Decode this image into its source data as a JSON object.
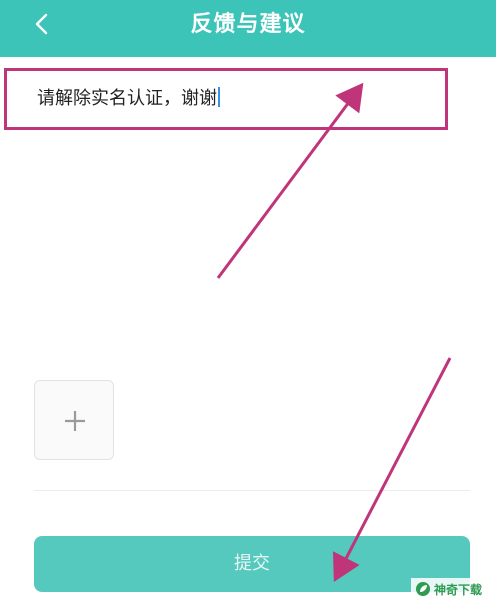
{
  "header": {
    "title": "反馈与建议"
  },
  "feedback": {
    "text": "请解除实名认证，谢谢"
  },
  "submit": {
    "label": "提交"
  },
  "watermark": {
    "text": "神奇下载"
  },
  "colors": {
    "header_bg": "#3cc4b8",
    "submit_bg": "#56c9bf",
    "highlight": "#c0357a"
  }
}
